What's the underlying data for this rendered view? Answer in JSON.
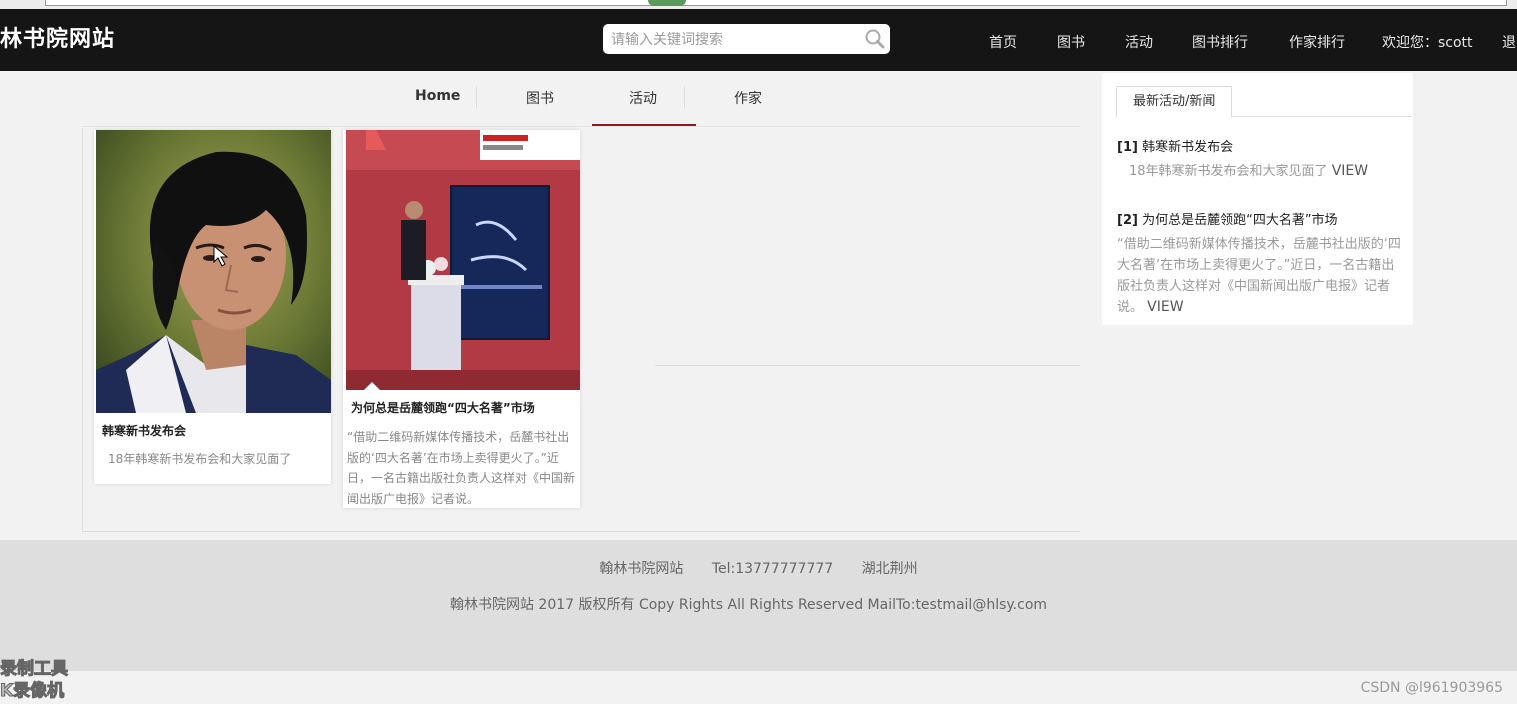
{
  "header": {
    "brand": "林书院网站",
    "search_placeholder": "请输入关键词搜索",
    "nav": [
      "首页",
      "图书",
      "活动",
      "图书排行",
      "作家排行"
    ],
    "welcome": "欢迎您：scott",
    "logout": "退"
  },
  "subnav": {
    "tabs": [
      "Home",
      "图书",
      "活动",
      "作家"
    ],
    "active": "活动"
  },
  "cards": [
    {
      "title": "韩寒新书发布会",
      "desc": "18年韩寒新书发布会和大家见面了"
    },
    {
      "title": "为何总是岳麓领跑“四大名著”市场",
      "desc": "“借助二维码新媒体传播技术，岳麓书社出版的‘四大名著’在市场上卖得更火了。”近日，一名古籍出版社负责人这样对《中国新闻出版广电报》记者说。"
    }
  ],
  "sidebar": {
    "tab_label": "最新活动/新闻",
    "items": [
      {
        "index": "[1]",
        "title": "韩寒新书发布会",
        "desc": "18年韩寒新书发布会和大家见面了",
        "link": "VIEW"
      },
      {
        "index": "[2]",
        "title": "为何总是岳麓领跑“四大名著”市场",
        "desc": "“借助二维码新媒体传播技术，岳麓书社出版的‘四大名著’在市场上卖得更火了。”近日，一名古籍出版社负责人这样对《中国新闻出版广电报》记者说。",
        "link": "VIEW"
      }
    ]
  },
  "footer": {
    "site": "翰林书院网站",
    "tel": "Tel:13777777777",
    "location": "湖北荆州",
    "copyright": "翰林书院网站 2017 版权所有 Copy Rights All Rights Reserved MailTo:testmail@hlsy.com"
  },
  "overlay": {
    "recorder_line1": "录制工具",
    "recorder_line2": "K录像机",
    "watermark": "CSDN @l961903965"
  },
  "colors": {
    "header_bg": "#151515",
    "active_tab": "#8a1c1c",
    "footer_bg": "#dedede"
  }
}
